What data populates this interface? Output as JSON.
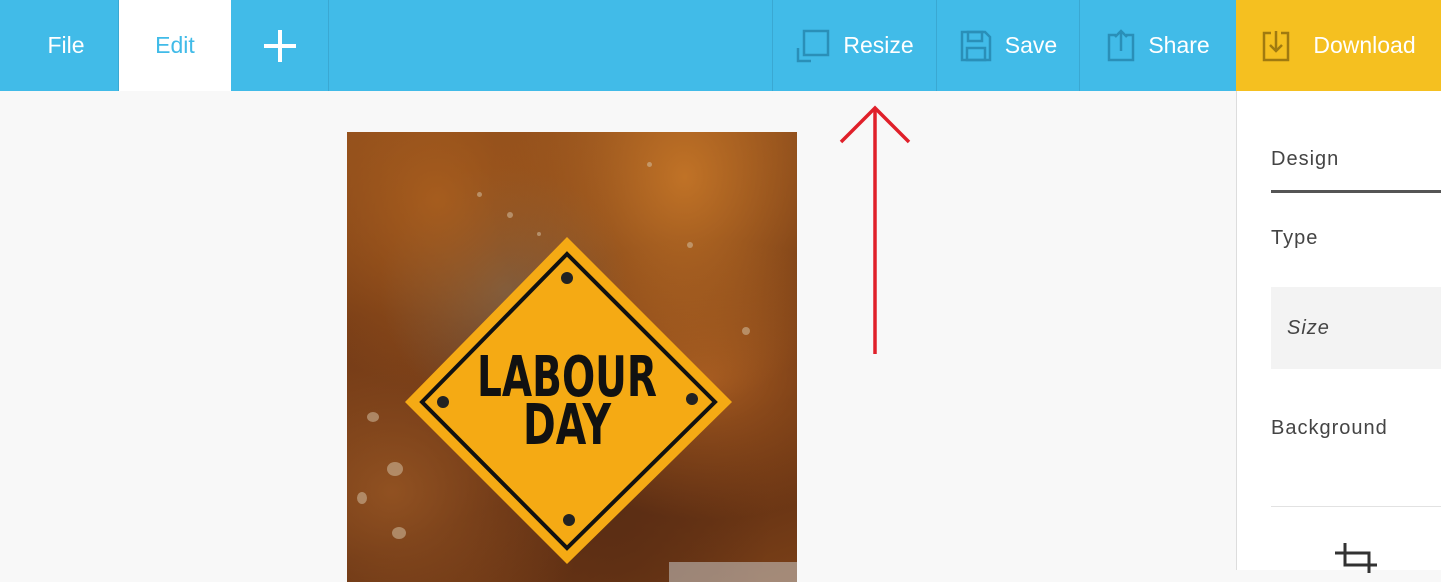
{
  "toolbar": {
    "file_label": "File",
    "edit_label": "Edit",
    "add_icon": "plus-icon",
    "resize_label": "Resize",
    "resize_icon": "resize-icon",
    "save_label": "Save",
    "save_icon": "floppy-disk-icon",
    "share_label": "Share",
    "share_icon": "upload-icon",
    "download_label": "Download",
    "download_icon": "download-icon",
    "colors": {
      "bar": "#41bbe8",
      "active_tab_bg": "#ffffff",
      "active_tab_text": "#41bbe8",
      "download_bg": "#f5c020"
    }
  },
  "canvas": {
    "sign_line1": "LABOUR",
    "sign_line2": "DAY",
    "sign_color": "#f5aa14"
  },
  "annotation": {
    "arrow_color": "#e0202a",
    "points_to": "resize-button"
  },
  "right_panel": {
    "tab_design": "Design",
    "type_label": "Type",
    "size_label": "Size",
    "background_label": "Background",
    "crop_icon": "crop-icon"
  }
}
